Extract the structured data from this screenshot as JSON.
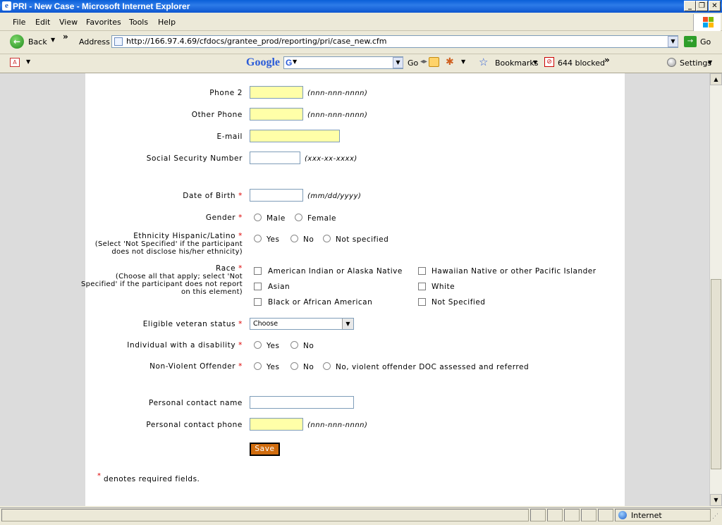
{
  "window": {
    "title": "PRI - New Case - Microsoft Internet Explorer",
    "minimize": "_",
    "maximize": "❐",
    "close": "✕"
  },
  "menu": [
    "File",
    "Edit",
    "View",
    "Favorites",
    "Tools",
    "Help"
  ],
  "nav": {
    "back_label": "Back",
    "chevrons": "»",
    "address_label": "Address",
    "url": "http://166.97.4.69/cfdocs/grantee_prod/reporting/pri/case_new.cfm",
    "go_label": "Go"
  },
  "google_toolbar": {
    "brand": "Google",
    "go_label": "Go",
    "bookmarks_label": "Bookmarks",
    "blocked_label": "644 blocked",
    "settings_label": "Settings",
    "chevrons": "»"
  },
  "form": {
    "phone2": {
      "label": "Phone 2",
      "hint": "(nnn-nnn-nnnn)"
    },
    "other_phone": {
      "label": "Other Phone",
      "hint": "(nnn-nnn-nnnn)"
    },
    "email": {
      "label": "E-mail"
    },
    "ssn": {
      "label": "Social Security Number",
      "hint": "(xxx-xx-xxxx)"
    },
    "dob": {
      "label": "Date of Birth",
      "hint": "(mm/dd/yyyy)"
    },
    "gender": {
      "label": "Gender",
      "options": [
        "Male",
        "Female"
      ]
    },
    "ethnicity": {
      "label": "Ethnicity Hispanic/Latino",
      "note": "(Select 'Not Specified' if the participant does not disclose his/her ethnicity)",
      "options": [
        "Yes",
        "No",
        "Not specified"
      ]
    },
    "race": {
      "label": "Race",
      "note": "(Choose all that apply; select 'Not Specified' if the participant does not report on this element)",
      "options": [
        "American Indian or Alaska Native",
        "Hawaiian Native or other Pacific Islander",
        "Asian",
        "White",
        "Black or African American",
        "Not Specified"
      ]
    },
    "veteran": {
      "label": "Eligible veteran status",
      "selected": "Choose"
    },
    "disability": {
      "label": "Individual with a disability",
      "options": [
        "Yes",
        "No"
      ]
    },
    "offender": {
      "label": "Non-Violent Offender",
      "options": [
        "Yes",
        "No",
        "No, violent offender DOC assessed and referred"
      ]
    },
    "contact_name": {
      "label": "Personal contact name"
    },
    "contact_phone": {
      "label": "Personal contact phone",
      "hint": "(nnn-nnn-nnnn)"
    },
    "save_label": "Save",
    "required_star": "*",
    "required_note": "denotes required fields."
  },
  "status": {
    "zone": "Internet"
  }
}
